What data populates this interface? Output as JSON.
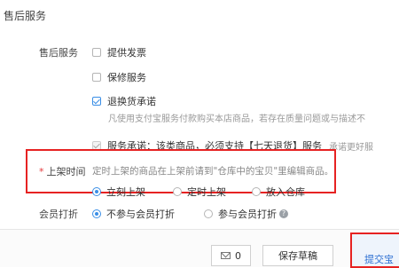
{
  "section_title": "售后服务",
  "after_sales": {
    "label": "售后服务",
    "options": [
      {
        "label": "提供发票",
        "checked": false
      },
      {
        "label": "保修服务",
        "checked": false
      },
      {
        "label": "退换货承诺",
        "checked": true
      }
    ],
    "return_note": "凡使用支付宝服务付款购买本店商品，若存在质量问题或与描述不",
    "service_promise": {
      "label": "服务承诺：该类商品，必须支持【七天退货】服务",
      "suffix": "承诺更好服"
    }
  },
  "listing": {
    "required_mark": "*",
    "label": "上架时间",
    "hint": "定时上架的商品在上架前请到\"仓库中的宝贝\"里编辑商品。",
    "options": [
      "立刻上架",
      "定时上架",
      "放入仓库"
    ],
    "selected": "立刻上架"
  },
  "member_discount": {
    "label": "会员打折",
    "options": [
      "不参与会员打折",
      "参与会员打折"
    ],
    "selected": "不参与会员打折"
  },
  "footer": {
    "mail_count": "0",
    "save_draft": "保存草稿",
    "submit": "提交宝"
  },
  "colors": {
    "accent": "#3a8ee6",
    "highlight": "#e62222",
    "required": "#e4393c"
  }
}
